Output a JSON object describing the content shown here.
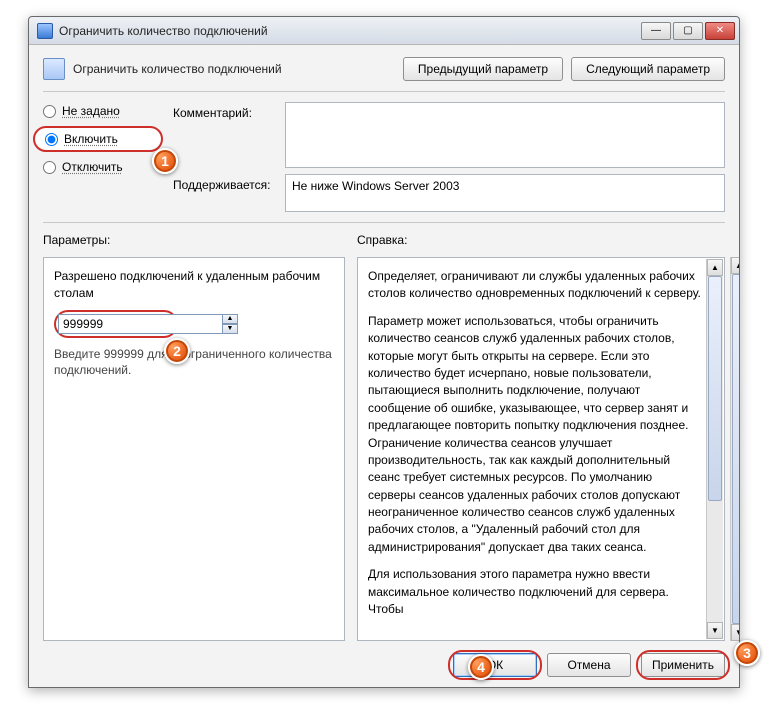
{
  "window": {
    "title": "Ограничить количество подключений"
  },
  "header": {
    "policy_title": "Ограничить количество подключений",
    "prev_button": "Предыдущий параметр",
    "next_button": "Следующий параметр"
  },
  "radios": {
    "not_configured": "Не задано",
    "enabled": "Включить",
    "disabled": "Отключить",
    "selected": "enabled"
  },
  "fields": {
    "comment_label": "Комментарий:",
    "comment_value": "",
    "supported_label": "Поддерживается:",
    "supported_value": "Не ниже Windows Server 2003"
  },
  "sections": {
    "options_label": "Параметры:",
    "help_label": "Справка:"
  },
  "options": {
    "param_label": "Разрешено подключений к удаленным рабочим столам",
    "param_value": "999999",
    "hint": "Введите 999999 для неограниченного количества подключений."
  },
  "help": {
    "p1": "Определяет, ограничивают ли службы удаленных рабочих столов количество одновременных подключений к серверу.",
    "p2": "Параметр может использоваться, чтобы ограничить количество сеансов служб удаленных рабочих столов, которые могут быть открыты на сервере. Если это количество будет исчерпано, новые пользователи, пытающиеся выполнить подключение, получают сообщение об ошибке, указывающее, что сервер занят и предлагающее повторить попытку подключения позднее. Ограничение количества сеансов улучшает производительность, так как каждый дополнительный сеанс требует системных ресурсов. По умолчанию серверы сеансов удаленных рабочих столов допускают неограниченное количество сеансов служб удаленных рабочих столов, а \"Удаленный рабочий стол для администрирования\" допускает два таких сеанса.",
    "p3": "Для использования этого параметра нужно ввести максимальное количество подключений для сервера. Чтобы"
  },
  "buttons": {
    "ok": "ОК",
    "cancel": "Отмена",
    "apply": "Применить"
  },
  "badges": {
    "b1": "1",
    "b2": "2",
    "b3": "3",
    "b4": "4"
  }
}
